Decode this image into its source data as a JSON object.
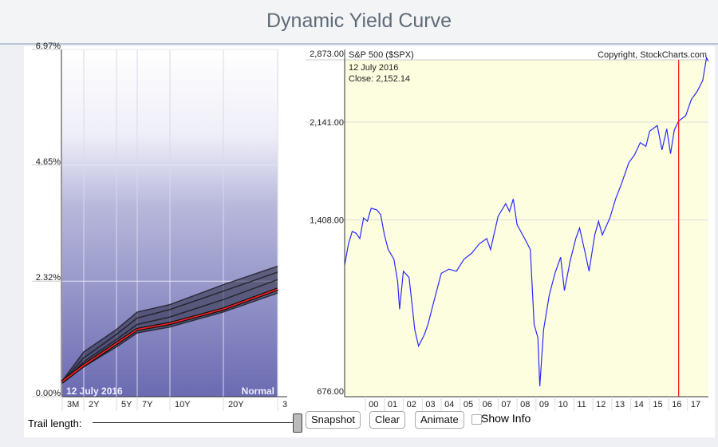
{
  "title": "Dynamic Yield Curve",
  "yield_chart": {
    "date_label": "12  July 2016",
    "shape_label": "Normal",
    "y_ticks": [
      "0.00%",
      "2.32%",
      "4.65%",
      "6.97%"
    ]
  },
  "spx_chart": {
    "title": "S&P 500 ($SPX)",
    "copyright": "Copyright, StockCharts.com",
    "date": "12  July 2016",
    "close": "Close: 2,152.14",
    "y_ticks": [
      "676.00",
      "1,408.00",
      "2,141.00",
      "2,873.00"
    ]
  },
  "controls": {
    "trail_label": "Trail length:",
    "trail_value": 1.0,
    "snapshot": "Snapshot",
    "clear": "Clear",
    "animate": "Animate",
    "show_info": "Show Info",
    "show_info_checked": false
  },
  "chart_data": [
    {
      "type": "line",
      "title": "Yield Curve",
      "categories": [
        "3M",
        "2Y",
        "5Y",
        "7Y",
        "10Y",
        "20Y",
        "30Y"
      ],
      "maturity_years": [
        0.25,
        2,
        5,
        7,
        10,
        20,
        30
      ],
      "ylim": [
        0,
        6.97
      ],
      "series": [
        {
          "name": "12 July 2016",
          "color": "#ff2020",
          "values": [
            0.3,
            0.63,
            1.07,
            1.35,
            1.47,
            1.76,
            2.16
          ]
        }
      ],
      "trail": [
        [
          0.32,
          0.9,
          1.35,
          1.7,
          1.85,
          2.25,
          2.62
        ],
        [
          0.3,
          0.78,
          1.25,
          1.58,
          1.75,
          2.12,
          2.5
        ],
        [
          0.28,
          0.7,
          1.15,
          1.45,
          1.6,
          1.95,
          2.35
        ],
        [
          0.27,
          0.6,
          1.0,
          1.28,
          1.4,
          1.7,
          2.08
        ]
      ]
    },
    {
      "type": "line",
      "title": "S&P 500 ($SPX)",
      "xlabel": "",
      "ylabel": "",
      "x_ticks": [
        "00",
        "01",
        "02",
        "03",
        "04",
        "05",
        "06",
        "07",
        "08",
        "09",
        "10",
        "11",
        "12",
        "13",
        "14",
        "15",
        "16",
        "17"
      ],
      "xlim": [
        1998.9,
        2018.1
      ],
      "ylim": [
        676,
        2873
      ],
      "yscale": "log",
      "marker_year": 2016.53,
      "series": [
        {
          "name": "SPX",
          "color": "#2a2aff",
          "x": [
            1998.9,
            1999.1,
            1999.3,
            1999.5,
            1999.7,
            1999.9,
            2000.1,
            2000.3,
            2000.6,
            2000.8,
            2001.0,
            2001.2,
            2001.5,
            2001.7,
            2001.8,
            2002.0,
            2002.3,
            2002.5,
            2002.6,
            2002.8,
            2003.1,
            2003.3,
            2003.6,
            2004.0,
            2004.4,
            2004.8,
            2005.2,
            2005.6,
            2006.0,
            2006.4,
            2006.6,
            2007.0,
            2007.4,
            2007.6,
            2007.8,
            2008.0,
            2008.4,
            2008.7,
            2008.9,
            2009.1,
            2009.2,
            2009.4,
            2009.7,
            2010.0,
            2010.3,
            2010.5,
            2010.8,
            2011.1,
            2011.3,
            2011.6,
            2011.8,
            2012.1,
            2012.3,
            2012.5,
            2012.9,
            2013.2,
            2013.5,
            2013.9,
            2014.2,
            2014.5,
            2014.8,
            2015.0,
            2015.4,
            2015.65,
            2015.9,
            2016.1,
            2016.3,
            2016.53,
            2016.9,
            2017.2,
            2017.5,
            2017.8,
            2018.0,
            2018.1
          ],
          "values": [
            1160,
            1270,
            1340,
            1330,
            1300,
            1420,
            1400,
            1480,
            1470,
            1440,
            1320,
            1240,
            1190,
            1080,
            960,
            1130,
            1100,
            950,
            880,
            820,
            860,
            900,
            990,
            1120,
            1140,
            1130,
            1190,
            1220,
            1270,
            1300,
            1240,
            1430,
            1510,
            1460,
            1540,
            1380,
            1300,
            1240,
            900,
            850,
            690,
            880,
            1020,
            1120,
            1200,
            1040,
            1180,
            1300,
            1360,
            1220,
            1130,
            1320,
            1400,
            1320,
            1420,
            1540,
            1640,
            1800,
            1860,
            1960,
            1930,
            2060,
            2110,
            1900,
            2080,
            1870,
            2070,
            2152,
            2200,
            2360,
            2440,
            2560,
            2820,
            2780
          ]
        }
      ]
    }
  ]
}
